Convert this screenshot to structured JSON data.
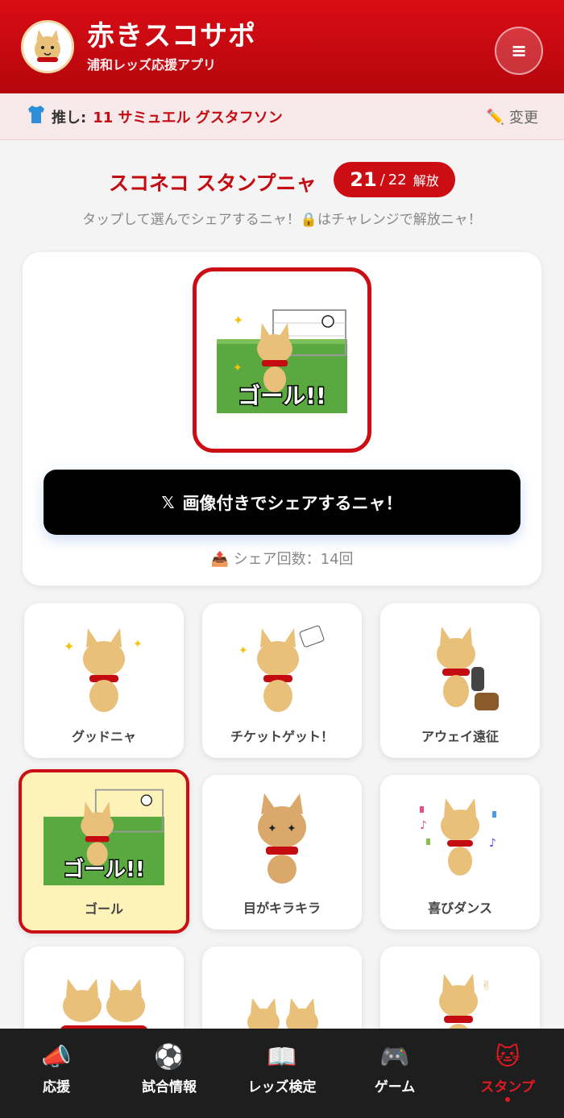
{
  "app": {
    "title": "赤きスコサポ",
    "subtitle": "浦和レッズ応援アプリ"
  },
  "favorite": {
    "label": "推し:",
    "player": "11 サミュエル グスタフソン",
    "change_label": "変更"
  },
  "stamps": {
    "title": "スコネコ スタンプニャ",
    "unlocked": "21",
    "separator": "/",
    "total": "22",
    "unlock_label": "解放",
    "hint": "タップして選んでシェアするニャ！🔒はチャレンジで解放ニャ！",
    "share_button": "画像付きでシェアするニャ！",
    "share_count": "シェア回数：14回",
    "items": [
      {
        "label": "グッドニャ"
      },
      {
        "label": "チケットゲット！"
      },
      {
        "label": "アウェイ遠征"
      },
      {
        "label": "ゴール"
      },
      {
        "label": "目がキラキラ"
      },
      {
        "label": "喜びダンス"
      },
      {
        "label": ""
      },
      {
        "label": ""
      },
      {
        "label": ""
      }
    ],
    "preview_text": "ゴール!!"
  },
  "nav": {
    "items": [
      {
        "label": "応援",
        "icon": "megaphone-icon"
      },
      {
        "label": "試合情報",
        "icon": "soccer-ball-icon"
      },
      {
        "label": "レッズ検定",
        "icon": "book-icon"
      },
      {
        "label": "ゲーム",
        "icon": "gamepad-icon"
      },
      {
        "label": "スタンプ",
        "icon": "cat-icon"
      }
    ]
  },
  "colors": {
    "brand_red": "#cc0d14",
    "selected_tile": "#fdf2b8"
  }
}
